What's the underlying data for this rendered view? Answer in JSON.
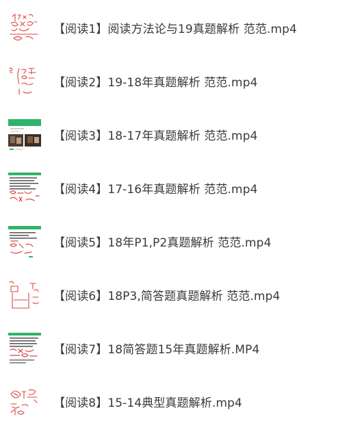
{
  "files": [
    {
      "name": "【阅读1】阅读方法论与19真题解析 范范.mp4",
      "thumbnail": "handwriting-sketch-thumbnail"
    },
    {
      "name": "【阅读2】19-18年真题解析 范范.mp4",
      "thumbnail": "handwriting-sketch-thumbnail"
    },
    {
      "name": "【阅读3】18-17年真题解析 范范.mp4",
      "thumbnail": "video-slide-thumbnail"
    },
    {
      "name": "【阅读4】17-16年真题解析 范范.mp4",
      "thumbnail": "annotated-text-thumbnail"
    },
    {
      "name": "【阅读5】18年P1,P2真题解析 范范.mp4",
      "thumbnail": "annotated-text-thumbnail"
    },
    {
      "name": "【阅读6】18P3,简答题真题解析 范范.mp4",
      "thumbnail": "handwriting-sketch-thumbnail"
    },
    {
      "name": "【阅读7】18简答题15年真题解析.MP4",
      "thumbnail": "annotated-text-thumbnail"
    },
    {
      "name": "【阅读8】15-14典型真题解析.mp4",
      "thumbnail": "handwriting-sketch-thumbnail"
    }
  ],
  "colors": {
    "text": "#3a3a3a",
    "ink_red": "#d9463b",
    "slide_green": "#2fb36a"
  }
}
